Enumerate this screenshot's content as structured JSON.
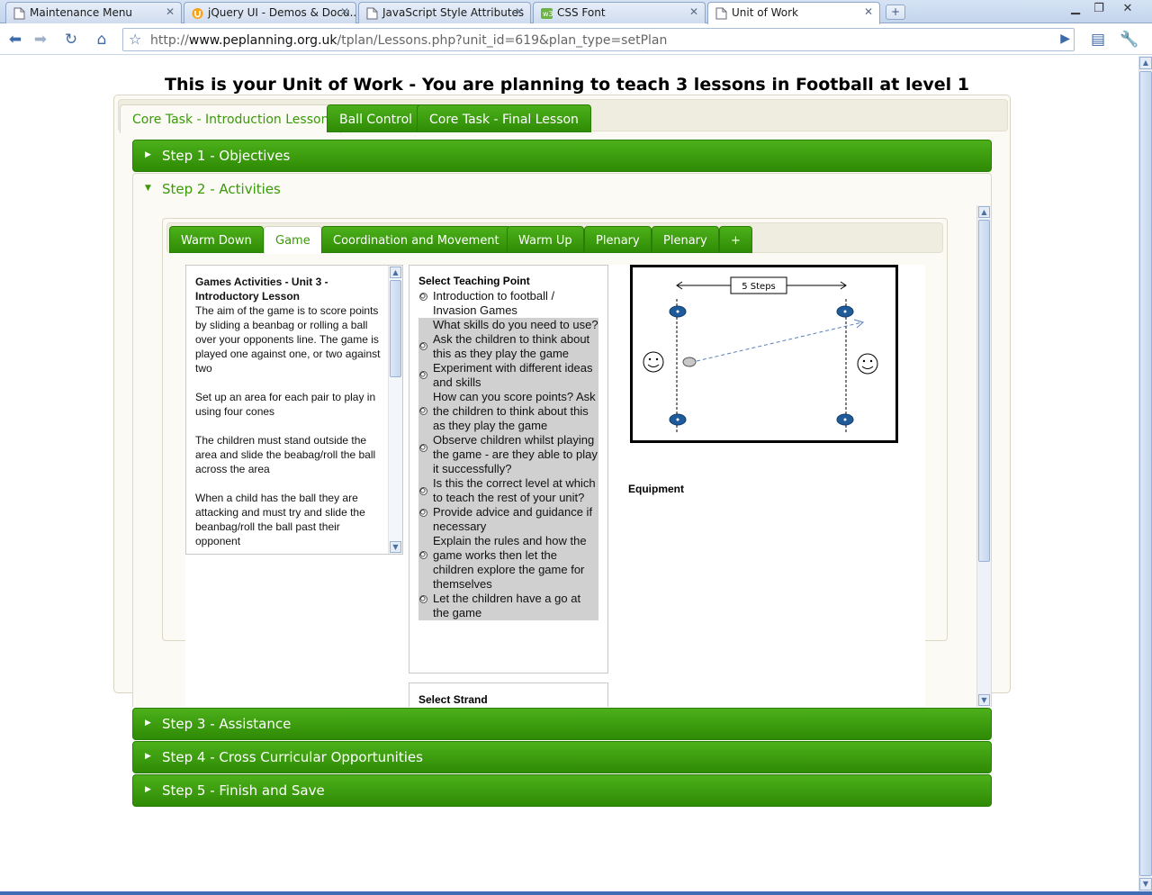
{
  "browser": {
    "tabs": [
      {
        "label": "Maintenance Menu",
        "active": false,
        "icon": "page-icon"
      },
      {
        "label": "jQuery UI - Demos & Docu...",
        "active": false,
        "icon": "jquery-icon"
      },
      {
        "label": "JavaScript Style Attributes",
        "active": false,
        "icon": "page-icon"
      },
      {
        "label": "CSS Font",
        "active": false,
        "icon": "w3schools-icon"
      },
      {
        "label": "Unit of Work",
        "active": true,
        "icon": "page-icon"
      }
    ],
    "url_prefix": "http://",
    "url_domain": "www.peplanning.org.uk",
    "url_path": "/tplan/Lessons.php?unit_id=619&plan_type=setPlan"
  },
  "page": {
    "title": "This is your Unit of Work - You are planning to teach 3 lessons in Football at level 1",
    "lesson_tabs": [
      "Core Task - Introduction Lesson",
      "Ball Control",
      "Core Task - Final Lesson"
    ],
    "steps": {
      "step1": "Step 1 - Objectives",
      "step2": "Step 2 - Activities",
      "step3": "Step 3 - Assistance",
      "step4": "Step 4 - Cross Curricular Opportunities",
      "step5": "Step 5 - Finish and Save"
    },
    "activity_tabs": [
      "Warm Down",
      "Game",
      "Coordination and Movement",
      "Warm Up",
      "Plenary",
      "Plenary",
      "+"
    ],
    "description": {
      "title": "Games Activities - Unit 3 - Introductory Lesson",
      "paragraphs": [
        "The aim of the game is to score points by sliding a beanbag or rolling a ball over your opponents line. The game is played one against one, or two against two",
        "Set up an area for each pair to play in using four cones",
        "The children must stand outside the area and slide the beabag/roll the ball across the area",
        "When a child has the ball they are attacking and must try and slide the beanbag/roll the ball past their opponent"
      ]
    },
    "teaching_point": {
      "title": "Select Teaching Point",
      "items": [
        {
          "text": "Introduction to football / Invasion Games",
          "highlighted": false
        },
        {
          "text": "What skills do you need to use? Ask the children to think about this as they play the game",
          "highlighted": true
        },
        {
          "text": "Experiment with different ideas and skills",
          "highlighted": true
        },
        {
          "text": "How can you score points? Ask the children to think about this as they play the game",
          "highlighted": true
        },
        {
          "text": "Observe children whilst playing the game - are they able to play it successfully?",
          "highlighted": true
        },
        {
          "text": "Is this the correct level at which to teach the rest of your unit?",
          "highlighted": true
        },
        {
          "text": "Provide advice and guidance if necessary",
          "highlighted": true
        },
        {
          "text": "Explain the rules and how the game works then let the children explore the game for themselves",
          "highlighted": true
        },
        {
          "text": "Let the children have a go at the game",
          "highlighted": true
        }
      ]
    },
    "strand": {
      "title": "Select Strand"
    },
    "diagram": {
      "label": "5 Steps"
    },
    "equipment_label": "Equipment"
  }
}
